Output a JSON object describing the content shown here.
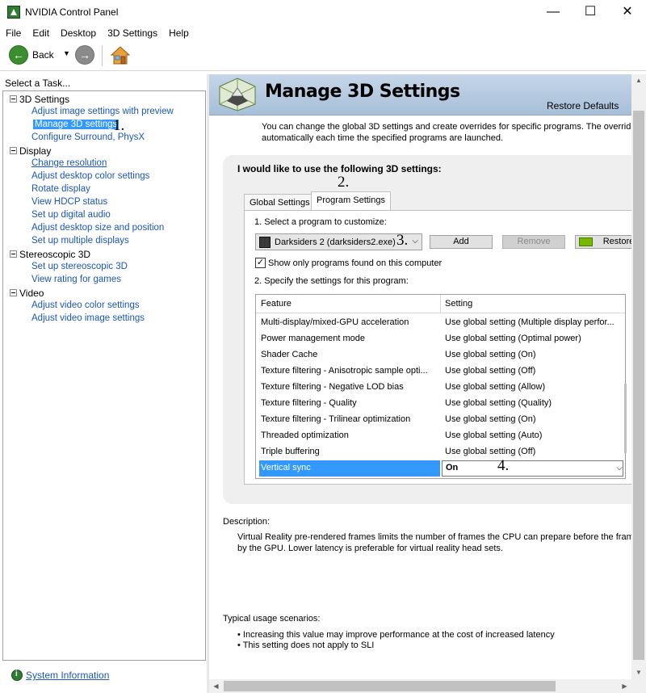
{
  "window": {
    "title": "NVIDIA Control Panel",
    "min_glyph": "—",
    "max_glyph": "☐",
    "close_glyph": "✕"
  },
  "menu": [
    "File",
    "Edit",
    "Desktop",
    "3D Settings",
    "Help"
  ],
  "toolbar": {
    "back_label": "Back",
    "dropdown_glyph": "▼",
    "back_glyph": "←",
    "forward_glyph": "→"
  },
  "sidebar": {
    "header": "Select a Task...",
    "categories": [
      {
        "label": "3D Settings",
        "items": [
          "Adjust image settings with preview",
          "Manage 3D settings",
          "Configure Surround, PhysX"
        ]
      },
      {
        "label": "Display",
        "items": [
          "Change resolution",
          "Adjust desktop color settings",
          "Rotate display",
          "View HDCP status",
          "Set up digital audio",
          "Adjust desktop size and position",
          "Set up multiple displays"
        ]
      },
      {
        "label": "Stereoscopic 3D",
        "items": [
          "Set up stereoscopic 3D",
          "View rating for games"
        ]
      },
      {
        "label": "Video",
        "items": [
          "Adjust video color settings",
          "Adjust video image settings"
        ]
      }
    ],
    "system_info": "System Information"
  },
  "main": {
    "title": "Manage 3D Settings",
    "restore_defaults": "Restore Defaults",
    "intro_line1": "You can change the global 3D settings and create overrides for specific programs. The overrides",
    "intro_line2": "automatically each time the specified programs are launched.",
    "group_title": "I would like to use the following 3D settings:",
    "tabs": [
      "Global Settings",
      "Program Settings"
    ],
    "select_program_label": "1. Select a program to customize:",
    "program": "Darksiders 2 (darksiders2.exe)",
    "add": "Add",
    "remove": "Remove",
    "restore": "Restore",
    "show_only_label": "Show only programs found on this computer",
    "show_only_checked": "✓",
    "specify_label": "2. Specify the settings for this program:",
    "table_headers": {
      "feature": "Feature",
      "setting": "Setting"
    },
    "rows": [
      {
        "feature": "Multi-display/mixed-GPU acceleration",
        "setting": "Use global setting (Multiple display perfor..."
      },
      {
        "feature": "Power management mode",
        "setting": "Use global setting (Optimal power)"
      },
      {
        "feature": "Shader Cache",
        "setting": "Use global setting (On)"
      },
      {
        "feature": "Texture filtering - Anisotropic sample opti...",
        "setting": "Use global setting (Off)"
      },
      {
        "feature": "Texture filtering - Negative LOD bias",
        "setting": "Use global setting (Allow)"
      },
      {
        "feature": "Texture filtering - Quality",
        "setting": "Use global setting (Quality)"
      },
      {
        "feature": "Texture filtering - Trilinear optimization",
        "setting": "Use global setting (On)"
      },
      {
        "feature": "Threaded optimization",
        "setting": "Use global setting (Auto)"
      },
      {
        "feature": "Triple buffering",
        "setting": "Use global setting (Off)"
      },
      {
        "feature": "Vertical sync",
        "setting": "On"
      }
    ],
    "description_label": "Description:",
    "description_line1": "Virtual Reality pre-rendered frames limits the number of frames the CPU can prepare before the frame",
    "description_line2": "by the GPU. Lower latency is preferable for virtual reality head sets.",
    "usage_label": "Typical usage scenarios:",
    "usage": [
      "• Increasing this value may improve performance at the cost of increased latency",
      "• This setting does not apply to SLI"
    ]
  },
  "annotations": [
    "1.",
    "2.",
    "3.",
    "4."
  ],
  "chevron_glyph": "⌵"
}
